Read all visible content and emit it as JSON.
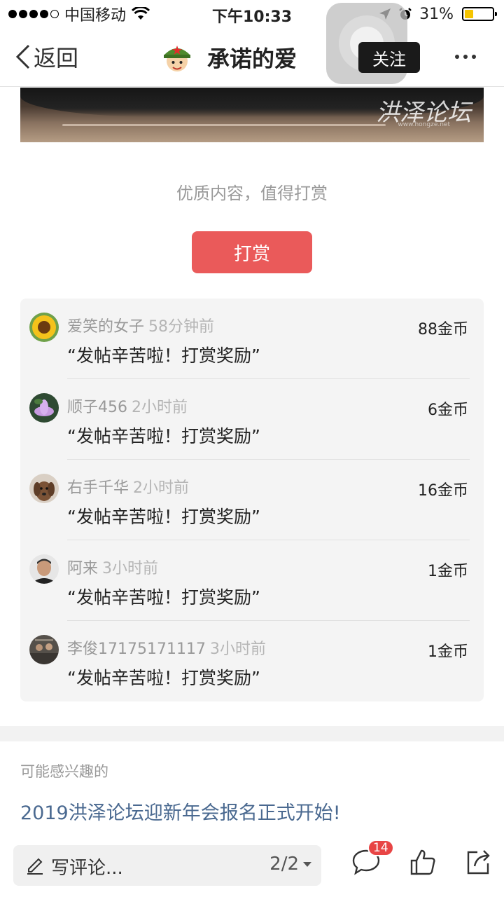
{
  "status_bar": {
    "carrier": "中国移动",
    "time": "下午10:33",
    "battery_percent": "31%",
    "battery_level": 0.31
  },
  "nav": {
    "back_label": "返回",
    "title": "承诺的爱",
    "follow_label": "关注"
  },
  "post_image": {
    "watermark": "洪泽论坛",
    "watermark_url": "www.hongze.net"
  },
  "reward": {
    "prompt": "优质内容，值得打赏",
    "button_label": "打赏"
  },
  "tips": [
    {
      "name": "爱笑的女子",
      "time": "58分钟前",
      "message": "“发帖辛苦啦！打赏奖励”",
      "coins": "88金币"
    },
    {
      "name": "顺子456",
      "time": "2小时前",
      "message": "“发帖辛苦啦！打赏奖励”",
      "coins": "6金币"
    },
    {
      "name": "右手千华",
      "time": "2小时前",
      "message": "“发帖辛苦啦！打赏奖励”",
      "coins": "16金币"
    },
    {
      "name": "阿来",
      "time": "3小时前",
      "message": "“发帖辛苦啦！打赏奖励”",
      "coins": "1金币"
    },
    {
      "name": "李俊17175171117",
      "time": "3小时前",
      "message": "“发帖辛苦啦！打赏奖励”",
      "coins": "1金币"
    }
  ],
  "interest": {
    "label": "可能感兴趣的",
    "link": "2019洪泽论坛迎新年会报名正式开始!"
  },
  "bottom_bar": {
    "comment_placeholder": "写评论...",
    "page_indicator": "2/2",
    "comment_badge": "14"
  },
  "colors": {
    "accent_red": "#ea5a5a",
    "link_blue": "#4a6990",
    "badge_red": "#e84545"
  }
}
